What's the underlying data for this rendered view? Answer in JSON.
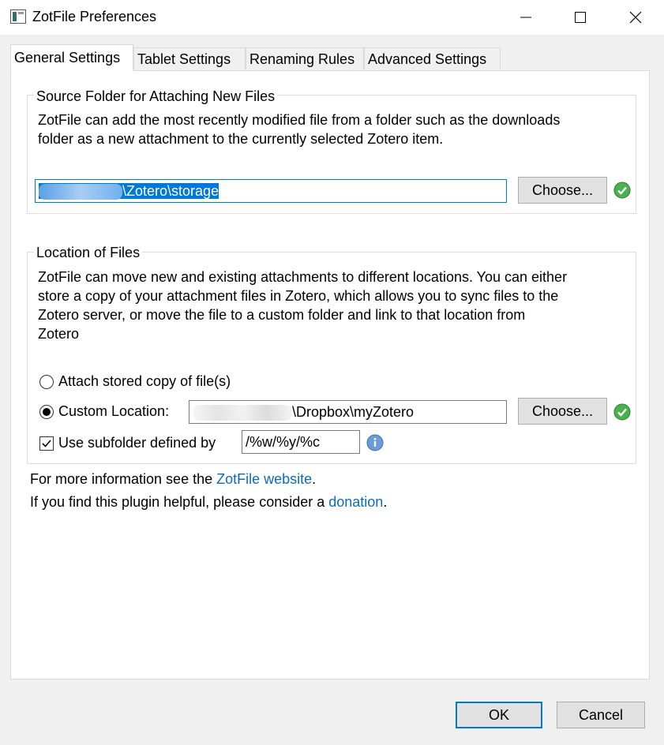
{
  "window": {
    "title": "ZotFile Preferences",
    "accent_color": "#0078d7",
    "link_color": "#0b6bbd"
  },
  "tabs": [
    {
      "label": "General Settings",
      "active": true
    },
    {
      "label": "Tablet Settings",
      "active": false
    },
    {
      "label": "Renaming Rules",
      "active": false
    },
    {
      "label": "Advanced Settings",
      "active": false
    }
  ],
  "source_folder": {
    "caption": "Source Folder for Attaching New Files",
    "description_line1": "ZotFile can add the most recently modified file from a folder such as the downloads",
    "description_line2": "folder as a new attachment to the currently selected Zotero item.",
    "path_value": "\\Zotero\\storage",
    "choose_label": "Choose..."
  },
  "location": {
    "caption": "Location of Files",
    "description_line1": "ZotFile can move new and existing attachments to different locations. You can either",
    "description_line2": "store a copy of your attachment files in Zotero, which allows you to sync files to the",
    "description_line3": "Zotero server, or move the file to a custom folder and link to that location from",
    "description_line4": "Zotero",
    "option_stored_label": "Attach stored copy of file(s)",
    "option_custom_label": "Custom Location:",
    "custom_selected": true,
    "custom_path_value": "\\Dropbox\\myZotero",
    "choose_label": "Choose...",
    "subfolder_label": "Use subfolder defined by",
    "subfolder_checked": true,
    "subfolder_value": "/%w/%y/%c"
  },
  "footer_info": {
    "line1_prefix": "For more information see the ",
    "line1_link": "ZotFile website",
    "line1_suffix": ".",
    "line2_prefix": "If you find this plugin helpful, please consider a ",
    "line2_link": "donation",
    "line2_suffix": "."
  },
  "dialog_buttons": {
    "ok_label": "OK",
    "cancel_label": "Cancel"
  }
}
